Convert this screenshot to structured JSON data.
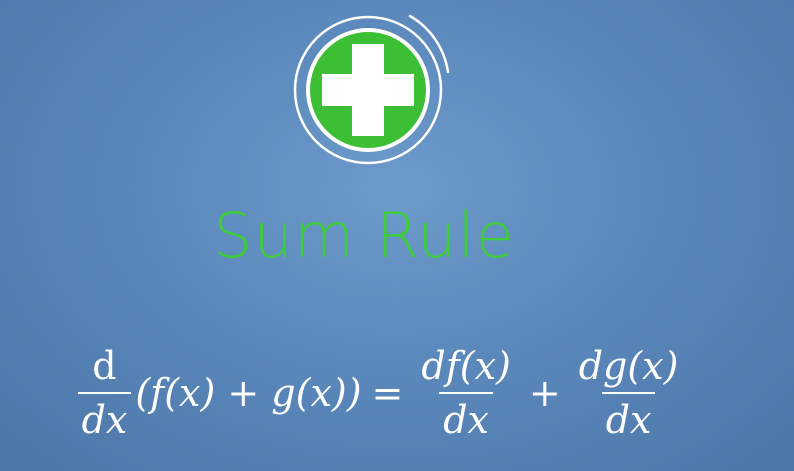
{
  "title": "Sum Rule",
  "formula": {
    "d_num": "d",
    "d_den": "dx",
    "lhs": "(f(x) + g(x))",
    "equals": "=",
    "frac1_num": "df(x)",
    "frac1_den": "dx",
    "plus": "+",
    "frac2_num": "dg(x)",
    "frac2_den": "dx"
  },
  "colors": {
    "title": "#3dcc3a",
    "plus_disc": "#3cbf34",
    "plus_sign": "#ffffff",
    "formula": "#ffffff"
  },
  "icons": {
    "logo": "plus-icon"
  }
}
